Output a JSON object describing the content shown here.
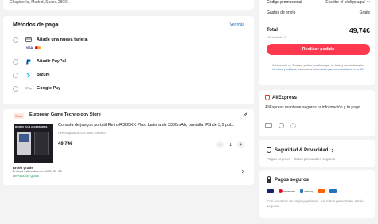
{
  "address": {
    "text": "Chapinería, Madrid, Spain, 28001"
  },
  "payment": {
    "title": "Métodos de pago",
    "more_link": "Ver más",
    "methods": [
      {
        "label": "Añade una nueva tarjeta",
        "icon": "card-icon"
      },
      {
        "label": "Añadir PayPal",
        "icon": "paypal-icon"
      },
      {
        "label": "Bizum",
        "icon": "bizum-icon"
      },
      {
        "label": "Google Pay",
        "icon": "gpay-icon",
        "icon_text": "GPay"
      }
    ],
    "card_logos": {
      "visa": "VISA"
    }
  },
  "store": {
    "badge": "Shop",
    "name": "European Game Technology Store",
    "product": {
      "image_banner": "RG35XX PLUS ACCESSORIES",
      "title": "Consola de juegos portátil Retro RG35XX Plus, batería de 3300mAh, pantalla IPS de 3,5 pul...",
      "variant": "Grey,España,64GB 5500 GAMES",
      "price": "49,74€",
      "quantity": "1",
      "minus": "−",
      "plus": "+"
    },
    "shipping": {
      "title": "Envío gratis",
      "date": "Entrega estimada entre AGO 22 - 26",
      "returns": "Devolución gratis"
    }
  },
  "summary": {
    "promo_label": "Código promocional",
    "promo_value": "Escribe el código aquí",
    "shipping_label": "Gastos de envío",
    "shipping_value": "Gratis",
    "total_label": "Total",
    "total_value": "49,74€",
    "iva": "IVA incluido ⓘ",
    "order_button": "Realizar pedido",
    "legal_pre": "Al hacer clic en 'Realizar pedido', confirmo que he leído y acepto todos los ",
    "legal_link1": "términos y políticas",
    "legal_mid": ", así como la ",
    "legal_link2": "Información para consumidores en la UE",
    "legal_post": "."
  },
  "aliexpress": {
    "brand": "AliExpress",
    "text": "AliExpress mantiene seguros tu información y tu pago"
  },
  "security": {
    "title": "Seguridad & Privacidad",
    "subtitle": "Pagos seguros · Datos personales seguros"
  },
  "safe_pay": {
    "title": "Pagos seguros",
    "logos": [
      "VISA",
      "Mastercard",
      "SafeKey",
      "Discover",
      "AMEX"
    ],
    "text": "Con nosotros de pago populares, tus datos personales están seguros"
  },
  "colors": {
    "accent": "#fd384f",
    "link": "#2a6ebb",
    "success": "#1f9d55"
  }
}
